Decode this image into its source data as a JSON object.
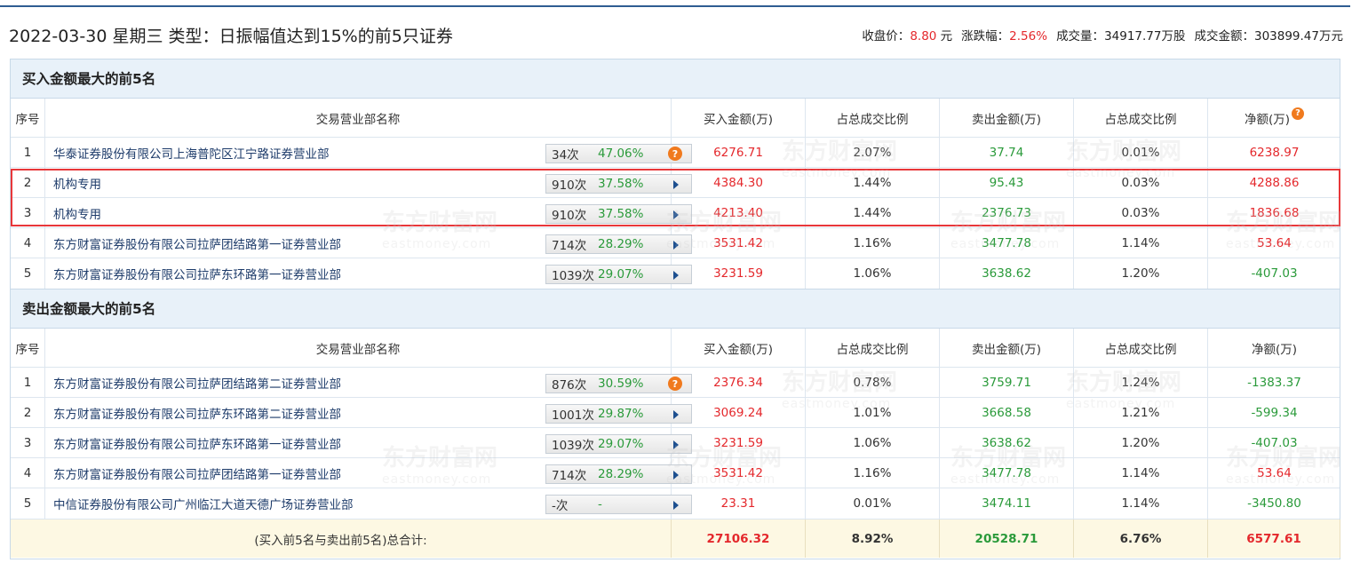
{
  "header": {
    "title": "2022-03-30 星期三 类型：日振幅值达到15%的前5只证券",
    "close_label": "收盘价：",
    "close_value": "8.80",
    "close_unit": "元",
    "change_label": "涨跌幅：",
    "change_value": "2.56%",
    "volume_label": "成交量：",
    "volume_value": "34917.77万股",
    "amount_label": "成交金额：",
    "amount_value": "303899.47万元"
  },
  "watermark": {
    "cn": "东方财富网",
    "en": "eastmoney.com"
  },
  "columns": {
    "idx": "序号",
    "name": "交易营业部名称",
    "buy": "买入金额(万)",
    "buy_pct": "占总成交比例",
    "sell": "卖出金额(万)",
    "sell_pct": "占总成交比例",
    "net": "净额(万)"
  },
  "buy_section": {
    "title": "买入金额最大的前5名",
    "rows": [
      {
        "idx": "1",
        "name": "华泰证券股份有限公司上海普陀区江宁路证券营业部",
        "count": "34次",
        "rate": "47.06%",
        "icon": "question",
        "buy": "6276.71",
        "buy_pct": "2.07%",
        "sell": "37.74",
        "sell_pct": "0.01%",
        "net": "6238.97"
      },
      {
        "idx": "2",
        "name": "机构专用",
        "count": "910次",
        "rate": "37.58%",
        "icon": "arrow",
        "buy": "4384.30",
        "buy_pct": "1.44%",
        "sell": "95.43",
        "sell_pct": "0.03%",
        "net": "4288.86"
      },
      {
        "idx": "3",
        "name": "机构专用",
        "count": "910次",
        "rate": "37.58%",
        "icon": "arrow",
        "buy": "4213.40",
        "buy_pct": "1.44%",
        "sell": "2376.73",
        "sell_pct": "0.03%",
        "net": "1836.68"
      },
      {
        "idx": "4",
        "name": "东方财富证券股份有限公司拉萨团结路第一证券营业部",
        "count": "714次",
        "rate": "28.29%",
        "icon": "arrow",
        "buy": "3531.42",
        "buy_pct": "1.16%",
        "sell": "3477.78",
        "sell_pct": "1.14%",
        "net": "53.64"
      },
      {
        "idx": "5",
        "name": "东方财富证券股份有限公司拉萨东环路第一证券营业部",
        "count": "1039次",
        "rate": "29.07%",
        "icon": "arrow",
        "buy": "3231.59",
        "buy_pct": "1.06%",
        "sell": "3638.62",
        "sell_pct": "1.20%",
        "net": "-407.03"
      }
    ]
  },
  "sell_section": {
    "title": "卖出金额最大的前5名",
    "rows": [
      {
        "idx": "1",
        "name": "东方财富证券股份有限公司拉萨团结路第二证券营业部",
        "count": "876次",
        "rate": "30.59%",
        "icon": "question",
        "buy": "2376.34",
        "buy_pct": "0.78%",
        "sell": "3759.71",
        "sell_pct": "1.24%",
        "net": "-1383.37"
      },
      {
        "idx": "2",
        "name": "东方财富证券股份有限公司拉萨东环路第二证券营业部",
        "count": "1001次",
        "rate": "29.87%",
        "icon": "arrow",
        "buy": "3069.24",
        "buy_pct": "1.01%",
        "sell": "3668.58",
        "sell_pct": "1.21%",
        "net": "-599.34"
      },
      {
        "idx": "3",
        "name": "东方财富证券股份有限公司拉萨东环路第一证券营业部",
        "count": "1039次",
        "rate": "29.07%",
        "icon": "arrow",
        "buy": "3231.59",
        "buy_pct": "1.06%",
        "sell": "3638.62",
        "sell_pct": "1.20%",
        "net": "-407.03"
      },
      {
        "idx": "4",
        "name": "东方财富证券股份有限公司拉萨团结路第一证券营业部",
        "count": "714次",
        "rate": "28.29%",
        "icon": "arrow",
        "buy": "3531.42",
        "buy_pct": "1.16%",
        "sell": "3477.78",
        "sell_pct": "1.14%",
        "net": "53.64"
      },
      {
        "idx": "5",
        "name": "中信证券股份有限公司广州临江大道天德广场证券营业部",
        "count": "-次",
        "rate": "-",
        "icon": "arrow",
        "buy": "23.31",
        "buy_pct": "0.01%",
        "sell": "3474.11",
        "sell_pct": "1.14%",
        "net": "-3450.80"
      }
    ]
  },
  "total": {
    "label": "(买入前5名与卖出前5名)总合计:",
    "buy": "27106.32",
    "buy_pct": "8.92%",
    "sell": "20528.71",
    "sell_pct": "6.76%",
    "net": "6577.61"
  },
  "colors": {
    "up": "#e4282c",
    "down": "#2a9a3a",
    "link": "#1d3b6a",
    "highlight": "#e8373a",
    "section_bg": "#e8f1f9",
    "total_bg": "#fdf8e3"
  }
}
